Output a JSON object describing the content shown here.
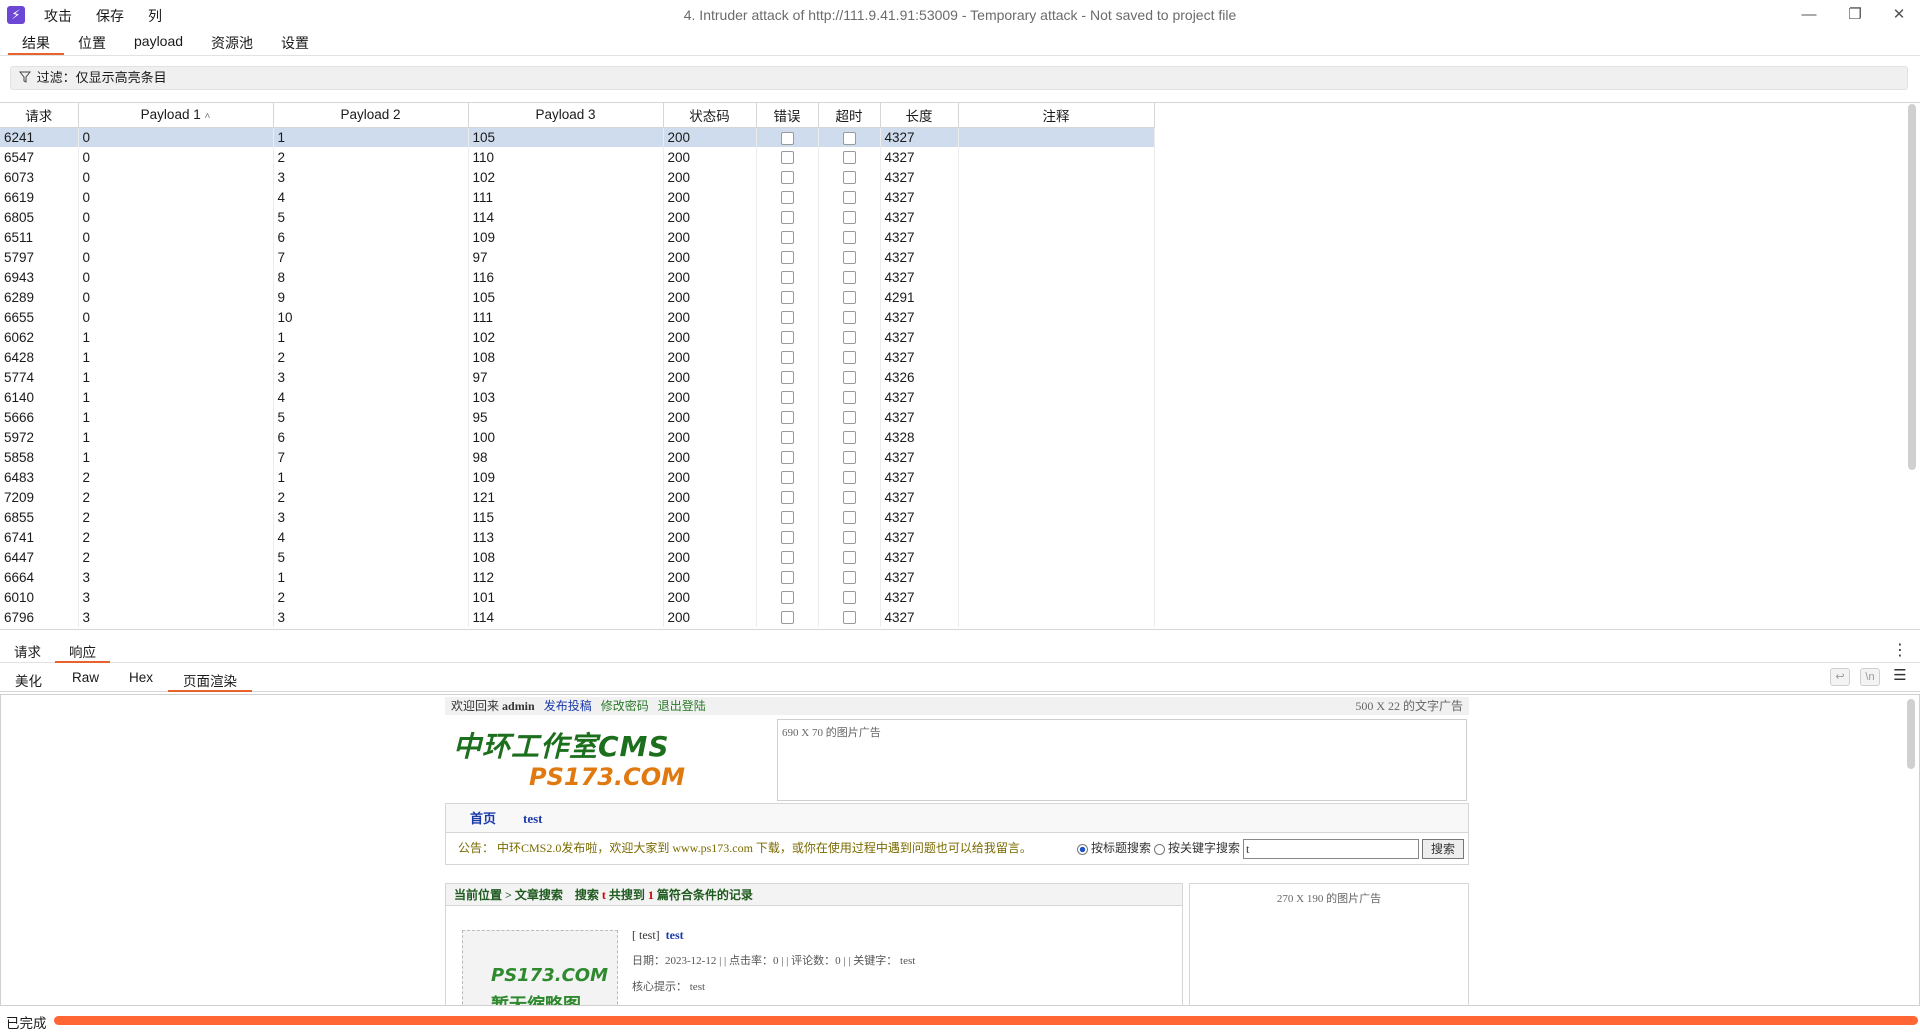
{
  "app": {
    "menu": [
      "攻击",
      "保存",
      "列"
    ],
    "window_title": "4. Intruder attack of http://111.9.41.91:53009 - Temporary attack - Not saved to project file"
  },
  "main_tabs": [
    "结果",
    "位置",
    "payload",
    "资源池",
    "设置"
  ],
  "filter_label": "过滤：仅显示高亮条目",
  "columns": [
    "请求",
    "Payload 1",
    "Payload 2",
    "Payload 3",
    "状态码",
    "错误",
    "超时",
    "长度",
    "注释"
  ],
  "rows": [
    [
      "6241",
      "0",
      "1",
      "105",
      "200",
      "4327"
    ],
    [
      "6547",
      "0",
      "2",
      "110",
      "200",
      "4327"
    ],
    [
      "6073",
      "0",
      "3",
      "102",
      "200",
      "4327"
    ],
    [
      "6619",
      "0",
      "4",
      "111",
      "200",
      "4327"
    ],
    [
      "6805",
      "0",
      "5",
      "114",
      "200",
      "4327"
    ],
    [
      "6511",
      "0",
      "6",
      "109",
      "200",
      "4327"
    ],
    [
      "5797",
      "0",
      "7",
      "97",
      "200",
      "4327"
    ],
    [
      "6943",
      "0",
      "8",
      "116",
      "200",
      "4327"
    ],
    [
      "6289",
      "0",
      "9",
      "105",
      "200",
      "4291"
    ],
    [
      "6655",
      "0",
      "10",
      "111",
      "200",
      "4327"
    ],
    [
      "6062",
      "1",
      "1",
      "102",
      "200",
      "4327"
    ],
    [
      "6428",
      "1",
      "2",
      "108",
      "200",
      "4327"
    ],
    [
      "5774",
      "1",
      "3",
      "97",
      "200",
      "4326"
    ],
    [
      "6140",
      "1",
      "4",
      "103",
      "200",
      "4327"
    ],
    [
      "5666",
      "1",
      "5",
      "95",
      "200",
      "4327"
    ],
    [
      "5972",
      "1",
      "6",
      "100",
      "200",
      "4328"
    ],
    [
      "5858",
      "1",
      "7",
      "98",
      "200",
      "4327"
    ],
    [
      "6483",
      "2",
      "1",
      "109",
      "200",
      "4327"
    ],
    [
      "7209",
      "2",
      "2",
      "121",
      "200",
      "4327"
    ],
    [
      "6855",
      "2",
      "3",
      "115",
      "200",
      "4327"
    ],
    [
      "6741",
      "2",
      "4",
      "113",
      "200",
      "4327"
    ],
    [
      "6447",
      "2",
      "5",
      "108",
      "200",
      "4327"
    ],
    [
      "6664",
      "3",
      "1",
      "112",
      "200",
      "4327"
    ],
    [
      "6010",
      "3",
      "2",
      "101",
      "200",
      "4327"
    ],
    [
      "6796",
      "3",
      "3",
      "114",
      "200",
      "4327"
    ]
  ],
  "lower_tabs": [
    "请求",
    "响应"
  ],
  "view_tabs": [
    "美化",
    "Raw",
    "Hex",
    "页面渲染"
  ],
  "rendered": {
    "welcome_prefix": "欢迎回来",
    "user": "admin",
    "links": [
      "发布投稿",
      "修改密码",
      "退出登陆"
    ],
    "text_ad": "500 X 22 的文字广告",
    "logo_line1": "中环工作室CMS",
    "logo_line2": "PS173.COM",
    "image_ad": "690 X 70 的图片广告",
    "nav": [
      "首页",
      "test"
    ],
    "notice": "公告： 中环CMS2.0发布啦，欢迎大家到 www.ps173.com 下载，或你在使用过程中遇到问题也可以给我留言。",
    "radio1": "按标题搜索",
    "radio2": "按关键字搜索",
    "search_value": "t",
    "search_button": "搜索",
    "crumb_prefix": "当前位置 > 文章搜索",
    "crumb_search": "搜索",
    "crumb_term": "t",
    "crumb_found": "共搜到",
    "crumb_count": "1",
    "crumb_suffix": "篇符合条件的记录",
    "thumb_line1": "PS173.COM",
    "thumb_line2": "暂无缩略图",
    "article_tag": "[ test]",
    "article_title": "test",
    "article_meta": "日期：2023-12-12 | | 点击率：0 | | 评论数：0 | | 关键字： test",
    "article_hint": "核心提示： test",
    "side_ad": "270 X 190 的图片广告"
  },
  "status": {
    "text": "已完成",
    "progress": 1.0,
    "progress_color": "#ff6633"
  },
  "colors": {
    "accent": "#e8622b",
    "selected_row": "#cfdcee"
  }
}
